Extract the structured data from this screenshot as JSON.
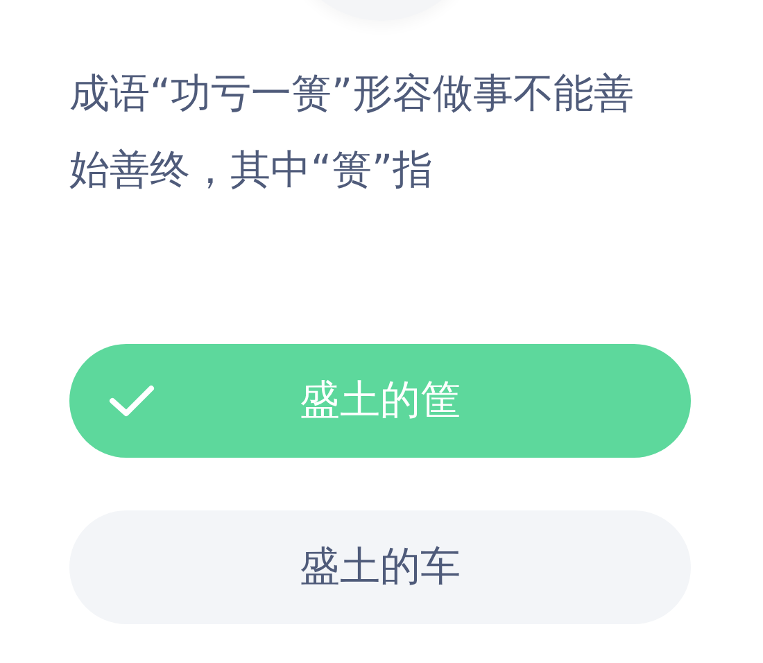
{
  "question": "成语“功亏一篑”形容做事不能善始善终，其中“篑”指",
  "options": [
    {
      "label": "盛土的筐",
      "selected": true
    },
    {
      "label": "盛土的车",
      "selected": false
    }
  ]
}
